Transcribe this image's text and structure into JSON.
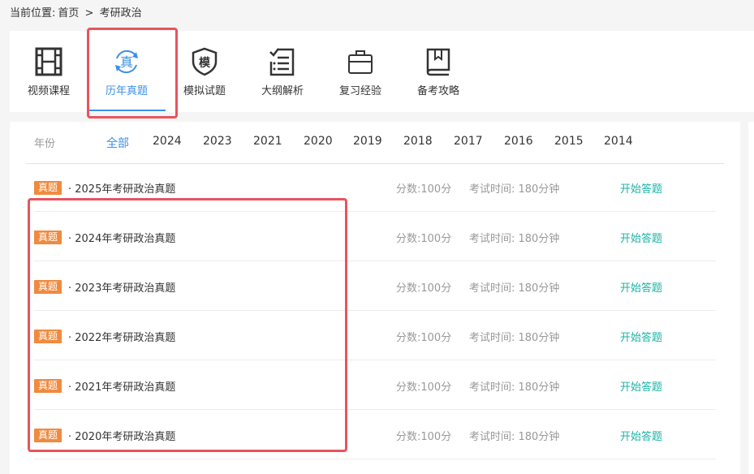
{
  "breadcrumb": {
    "prefix": "当前位置:",
    "home": "首页",
    "sep": ">",
    "current": "考研政治"
  },
  "tabs": [
    {
      "label": "视频课程",
      "icon": "film-icon"
    },
    {
      "label": "历年真题",
      "icon": "zhen-cycle-icon",
      "icon_char": "真",
      "active": true
    },
    {
      "label": "模拟试题",
      "icon": "mo-shield-icon",
      "icon_char": "模"
    },
    {
      "label": "大纲解析",
      "icon": "checklist-icon"
    },
    {
      "label": "复习经验",
      "icon": "briefcase-icon"
    },
    {
      "label": "备考攻略",
      "icon": "book-icon"
    }
  ],
  "years": {
    "label": "年份",
    "items": [
      "全部",
      "2024",
      "2023",
      "2021",
      "2020",
      "2019",
      "2018",
      "2017",
      "2016",
      "2015",
      "2014"
    ],
    "active_index": 0
  },
  "exams": [
    {
      "badge": "真题",
      "title": "· 2025年考研政治真题",
      "score": "分数:100分",
      "time": "考试时间: 180分钟",
      "action": "开始答题"
    },
    {
      "badge": "真题",
      "title": "· 2024年考研政治真题",
      "score": "分数:100分",
      "time": "考试时间: 180分钟",
      "action": "开始答题"
    },
    {
      "badge": "真题",
      "title": "· 2023年考研政治真题",
      "score": "分数:100分",
      "time": "考试时间: 180分钟",
      "action": "开始答题"
    },
    {
      "badge": "真题",
      "title": "· 2022年考研政治真题",
      "score": "分数:100分",
      "time": "考试时间: 180分钟",
      "action": "开始答题"
    },
    {
      "badge": "真题",
      "title": "· 2021年考研政治真题",
      "score": "分数:100分",
      "time": "考试时间: 180分钟",
      "action": "开始答题"
    },
    {
      "badge": "真题",
      "title": "· 2020年考研政治真题",
      "score": "分数:100分",
      "time": "考试时间: 180分钟",
      "action": "开始答题"
    }
  ],
  "colors": {
    "accent": "#3b8fe8",
    "badge": "#f08a3e",
    "action": "#1ab3a6",
    "highlight": "#e8545f"
  }
}
